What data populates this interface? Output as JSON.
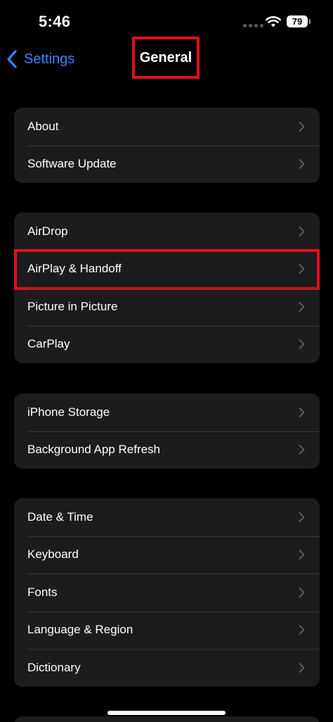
{
  "status_bar": {
    "time": "5:46",
    "battery": "79"
  },
  "nav": {
    "back_label": "Settings",
    "title": "General",
    "accent_color": "#3b82f6",
    "highlight_color": "#e0101a"
  },
  "groups": [
    {
      "rows": [
        {
          "label": "About"
        },
        {
          "label": "Software Update"
        }
      ]
    },
    {
      "rows": [
        {
          "label": "AirDrop"
        },
        {
          "label": "AirPlay & Handoff",
          "highlighted": true
        },
        {
          "label": "Picture in Picture"
        },
        {
          "label": "CarPlay"
        }
      ]
    },
    {
      "rows": [
        {
          "label": "iPhone Storage"
        },
        {
          "label": "Background App Refresh"
        }
      ]
    },
    {
      "rows": [
        {
          "label": "Date & Time"
        },
        {
          "label": "Keyboard"
        },
        {
          "label": "Fonts"
        },
        {
          "label": "Language & Region"
        },
        {
          "label": "Dictionary"
        }
      ]
    }
  ]
}
